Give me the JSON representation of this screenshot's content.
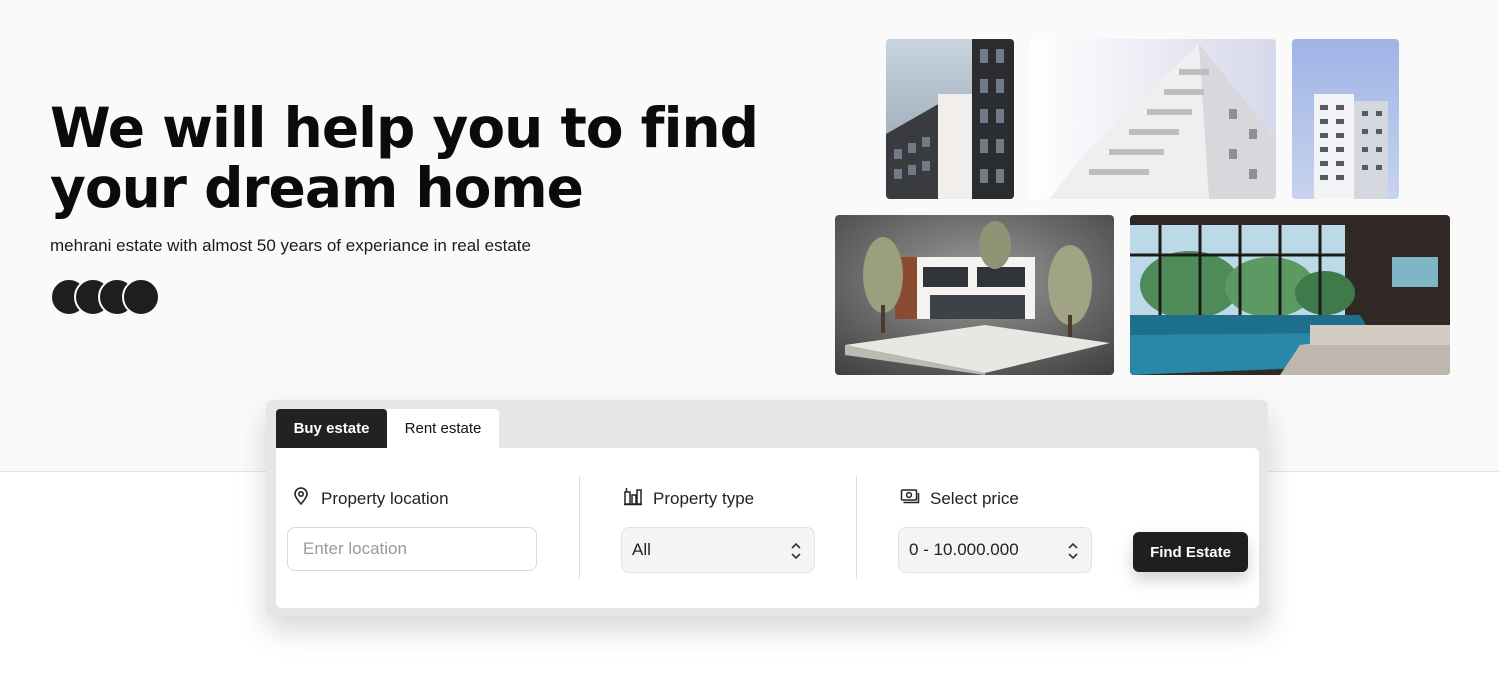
{
  "hero": {
    "title": "We will help you to find your dream home",
    "subtitle": "mehrani estate with almost 50 years of experiance in real estate",
    "avatars": [
      "avatar",
      "avatar",
      "avatar",
      "avatar"
    ]
  },
  "gallery": {
    "photos": [
      "dark-facade-building",
      "white-balcony-building",
      "tall-apartment-tower",
      "modern-villa-with-trees",
      "indoor-pool-room"
    ]
  },
  "search": {
    "tabs": {
      "buy": "Buy estate",
      "rent": "Rent estate",
      "active": "buy"
    },
    "location": {
      "label": "Property location",
      "placeholder": "Enter location",
      "value": "",
      "icon": "map-pin-icon"
    },
    "type": {
      "label": "Property type",
      "value": "All",
      "icon": "building-chart-icon"
    },
    "price": {
      "label": "Select price",
      "value": "0 - 10.000.000",
      "icon": "cash-icon"
    },
    "submit": "Find Estate"
  },
  "colors": {
    "dark": "#1f1f1f",
    "page_bg": "#fafafb",
    "panel_bg": "#e6e6e7"
  }
}
